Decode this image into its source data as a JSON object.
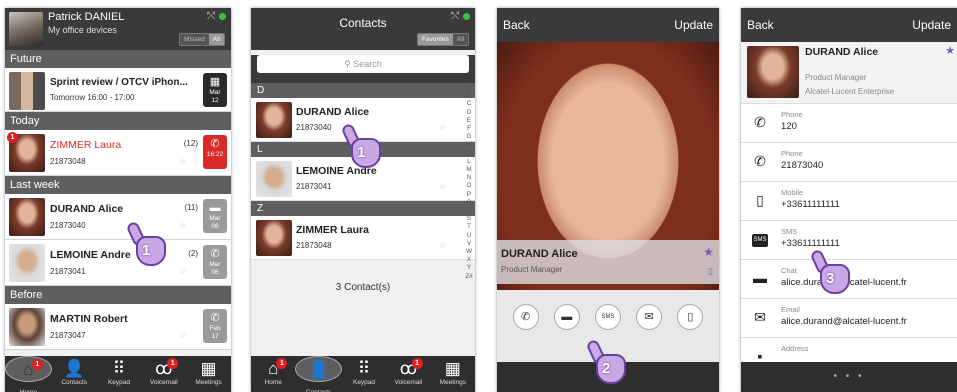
{
  "screen1": {
    "user_name": "Patrick DANIEL",
    "user_devices": "My office devices",
    "filters": [
      "Missed",
      "All"
    ],
    "sections": {
      "future": "Future",
      "today": "Today",
      "last_week": "Last week",
      "before": "Before"
    },
    "future_item": {
      "title": "Sprint review / OTCV iPhon...",
      "time": "Tomorrow 16:00 - 17:00",
      "month": "Mar",
      "day": "12"
    },
    "today_item": {
      "name": "ZIMMER Laura",
      "number": "21873048",
      "count": "(12)",
      "time": "16:22",
      "badge": "1"
    },
    "last_week_items": [
      {
        "name": "DURAND Alice",
        "number": "21873040",
        "count": "(11)",
        "month": "Mar",
        "day": "06"
      },
      {
        "name": "LEMOINE Andre",
        "number": "21873041",
        "count": "(2)",
        "month": "Mar",
        "day": "06"
      }
    ],
    "before_item": {
      "name": "MARTIN Robert",
      "number": "21873047",
      "month": "Feb",
      "day": "17"
    },
    "tabs": [
      {
        "label": "Home",
        "badge": "1"
      },
      {
        "label": "Contacts",
        "badge": ""
      },
      {
        "label": "Keypad",
        "badge": ""
      },
      {
        "label": "Voicemail",
        "badge": "1"
      },
      {
        "label": "Meetings",
        "badge": ""
      }
    ],
    "step": "1"
  },
  "screen2": {
    "title": "Contacts",
    "filters": [
      "Favorites",
      "All"
    ],
    "search_placeholder": "Search",
    "groups": [
      {
        "letter": "D",
        "name": "DURAND Alice",
        "number": "21873040"
      },
      {
        "letter": "L",
        "name": "LEMOINE Andre",
        "number": "21873041"
      },
      {
        "letter": "Z",
        "name": "ZIMMER Laura",
        "number": "21873048"
      }
    ],
    "alphabet": "ABCDEFGHIJKLMNOPQRSTUVWXYZ#",
    "count": "3 Contact(s)",
    "step": "1"
  },
  "screen3": {
    "back": "Back",
    "update": "Update",
    "name": "DURAND Alice",
    "position": "Product Manager",
    "actions": [
      "call-icon",
      "chat-icon",
      "sms-icon",
      "email-icon",
      "mobile-icon"
    ],
    "sms_label": "SMS",
    "step": "2"
  },
  "screen4": {
    "back": "Back",
    "update": "Update",
    "name": "DURAND Alice",
    "position": "Product Manager",
    "company": "Alcatel-Lucent Enterprise",
    "fields": [
      {
        "label": "Phone",
        "value": "120",
        "icon": "phone-icon"
      },
      {
        "label": "Phone",
        "value": "21873040",
        "icon": "phone-icon"
      },
      {
        "label": "Mobile",
        "value": "+33611111111",
        "icon": "mobile-icon"
      },
      {
        "label": "SMS",
        "value": "+33611111111",
        "icon": "sms-icon"
      },
      {
        "label": "Chat",
        "value": "alice.durand@alcatel-lucent.fr",
        "icon": "chat-icon"
      },
      {
        "label": "Email",
        "value": "alice.durand@alcatel-lucent.fr",
        "icon": "email-icon"
      },
      {
        "label": "Address",
        "value": "",
        "icon": "address-icon"
      }
    ],
    "sms_label": "SMS",
    "step": "3"
  }
}
